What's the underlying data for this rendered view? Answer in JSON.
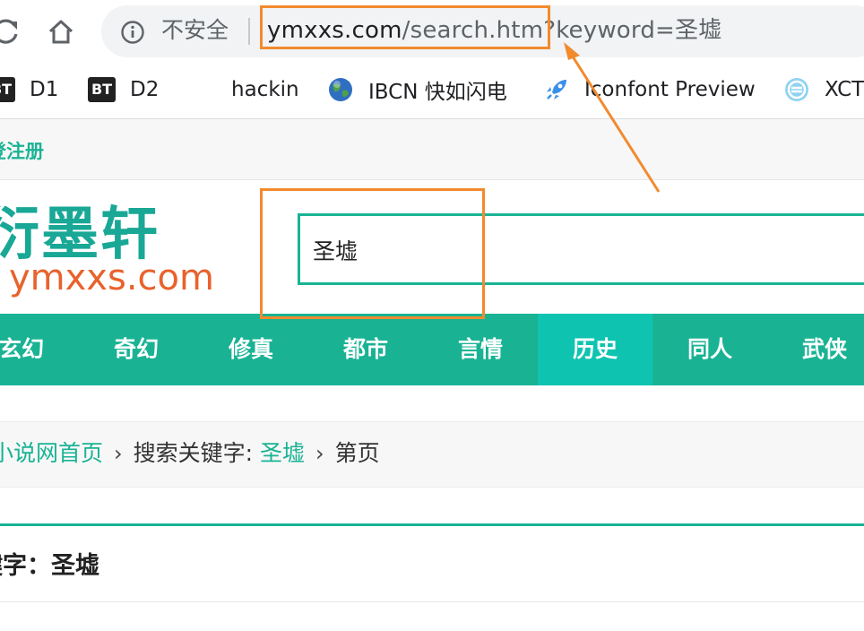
{
  "browser": {
    "security_label": "不安全",
    "url_host": "ymxxs.com",
    "url_path": "/search.htm?keyword=圣墟",
    "bookmarks": [
      {
        "label": "D1",
        "icon": "bt-icon",
        "icon_text": "BT"
      },
      {
        "label": "D2",
        "icon": "bt-icon",
        "icon_text": "BT"
      },
      {
        "label": "hackin",
        "icon": "none"
      },
      {
        "label": "IBCN 快如闪电",
        "icon": "globe-icon"
      },
      {
        "label": "Iconfont Preview",
        "icon": "rocket-icon"
      },
      {
        "label": "XCT",
        "icon": "web-icon"
      }
    ]
  },
  "page": {
    "topbar_link": "登注册",
    "logo": {
      "cn": "衍墨轩",
      "en": "ymxxs.com"
    },
    "search_value": "圣墟",
    "nav": [
      "玄幻",
      "奇幻",
      "修真",
      "都市",
      "言情",
      "历史",
      "同人",
      "武侠"
    ],
    "nav_active": "历史",
    "breadcrumb": {
      "home": "小说网首页",
      "sep": "›",
      "label": "搜索关键字:",
      "keyword": "圣墟",
      "page": "第页"
    },
    "result_title": "键字：圣墟"
  },
  "colors": {
    "accent": "#19b394",
    "nav_active": "#0ec4b0",
    "annotation": "#f28a2e",
    "logo_en": "#e8622c"
  }
}
